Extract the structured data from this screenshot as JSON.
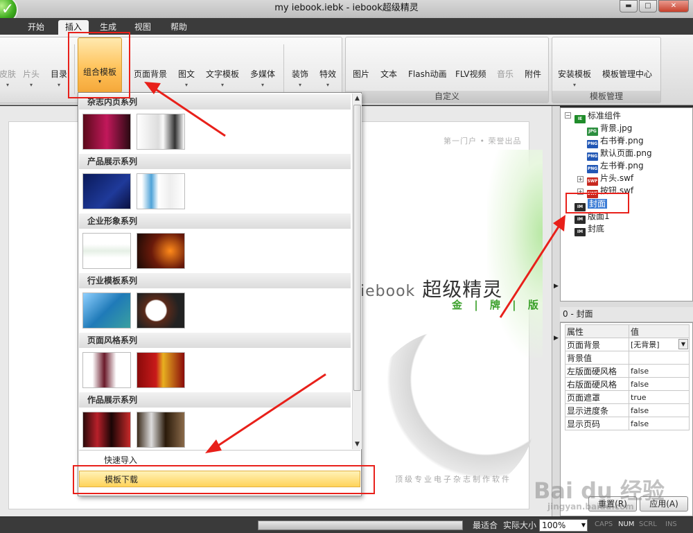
{
  "window": {
    "title": "my iebook.iebk - iebook超级精灵",
    "min_glyph": "▬",
    "max_glyph": "□",
    "close_glyph": "✕"
  },
  "menu": {
    "tabs": [
      "开始",
      "插入",
      "生成",
      "视图",
      "帮助"
    ],
    "active_tab": "插入"
  },
  "ribbon": {
    "group1": {
      "buttons": [
        "皮肤",
        "片头",
        "目录",
        "组合模板",
        "页面背景",
        "图文",
        "文字模板",
        "多媒体",
        "装饰",
        "特效"
      ]
    },
    "group2": {
      "label": "自定义",
      "buttons": [
        "图片",
        "文本",
        "Flash动画",
        "FLV视频",
        "音乐",
        "附件"
      ]
    },
    "group3": {
      "label": "模板管理",
      "buttons": [
        "安装模板",
        "模板管理中心"
      ]
    }
  },
  "dropdown": {
    "categories": [
      "杂志内页系列",
      "产品展示系列",
      "企业形象系列",
      "行业模板系列",
      "页面风格系列",
      "作品展示系列"
    ],
    "items": {
      "quick_import": "快速导入",
      "template_download": "模板下载"
    }
  },
  "canvas": {
    "tagline_top": "第一门户 • 荣誉出品",
    "logo_text": "iebook",
    "logo_cn": "超级精灵",
    "gold_line": "金 | 牌 | 版",
    "footer_line": "顶级专业电子杂志制作软件"
  },
  "tree": {
    "root": "标准组件",
    "children": [
      "背景.jpg",
      "右书脊.png",
      "默认页面.png",
      "左书脊.png",
      "片头.swf",
      "按钮.swf"
    ],
    "pages": [
      "封面",
      "版面1",
      "封底"
    ],
    "selected": "封面"
  },
  "properties": {
    "title": "0 - 封面",
    "header_name": "属性",
    "header_value": "值",
    "rows": [
      {
        "name": "页面背景",
        "value": "[无背景]"
      },
      {
        "name": "背景值",
        "value": ""
      },
      {
        "name": "左版面硬风格",
        "value": "false"
      },
      {
        "name": "右版面硬风格",
        "value": "false"
      },
      {
        "name": "页面遮罩",
        "value": "true"
      },
      {
        "name": "显示进度条",
        "value": "false"
      },
      {
        "name": "显示页码",
        "value": "false"
      }
    ],
    "reset_label": "重置(R)",
    "apply_label": "应用(A)"
  },
  "statusbar": {
    "fit": "最适合",
    "actual": "实际大小",
    "zoom": "100%",
    "caps": "CAPS",
    "num": "NUM",
    "scrl": "SCRL",
    "ins": "INS"
  },
  "watermark": {
    "logo": "Bai du 经验",
    "url": "jingyan.baidu.com"
  },
  "colors": {
    "annotation_red": "#e8201a",
    "active_orange": "#ffc35b",
    "selection_blue": "#3a7bd5"
  }
}
